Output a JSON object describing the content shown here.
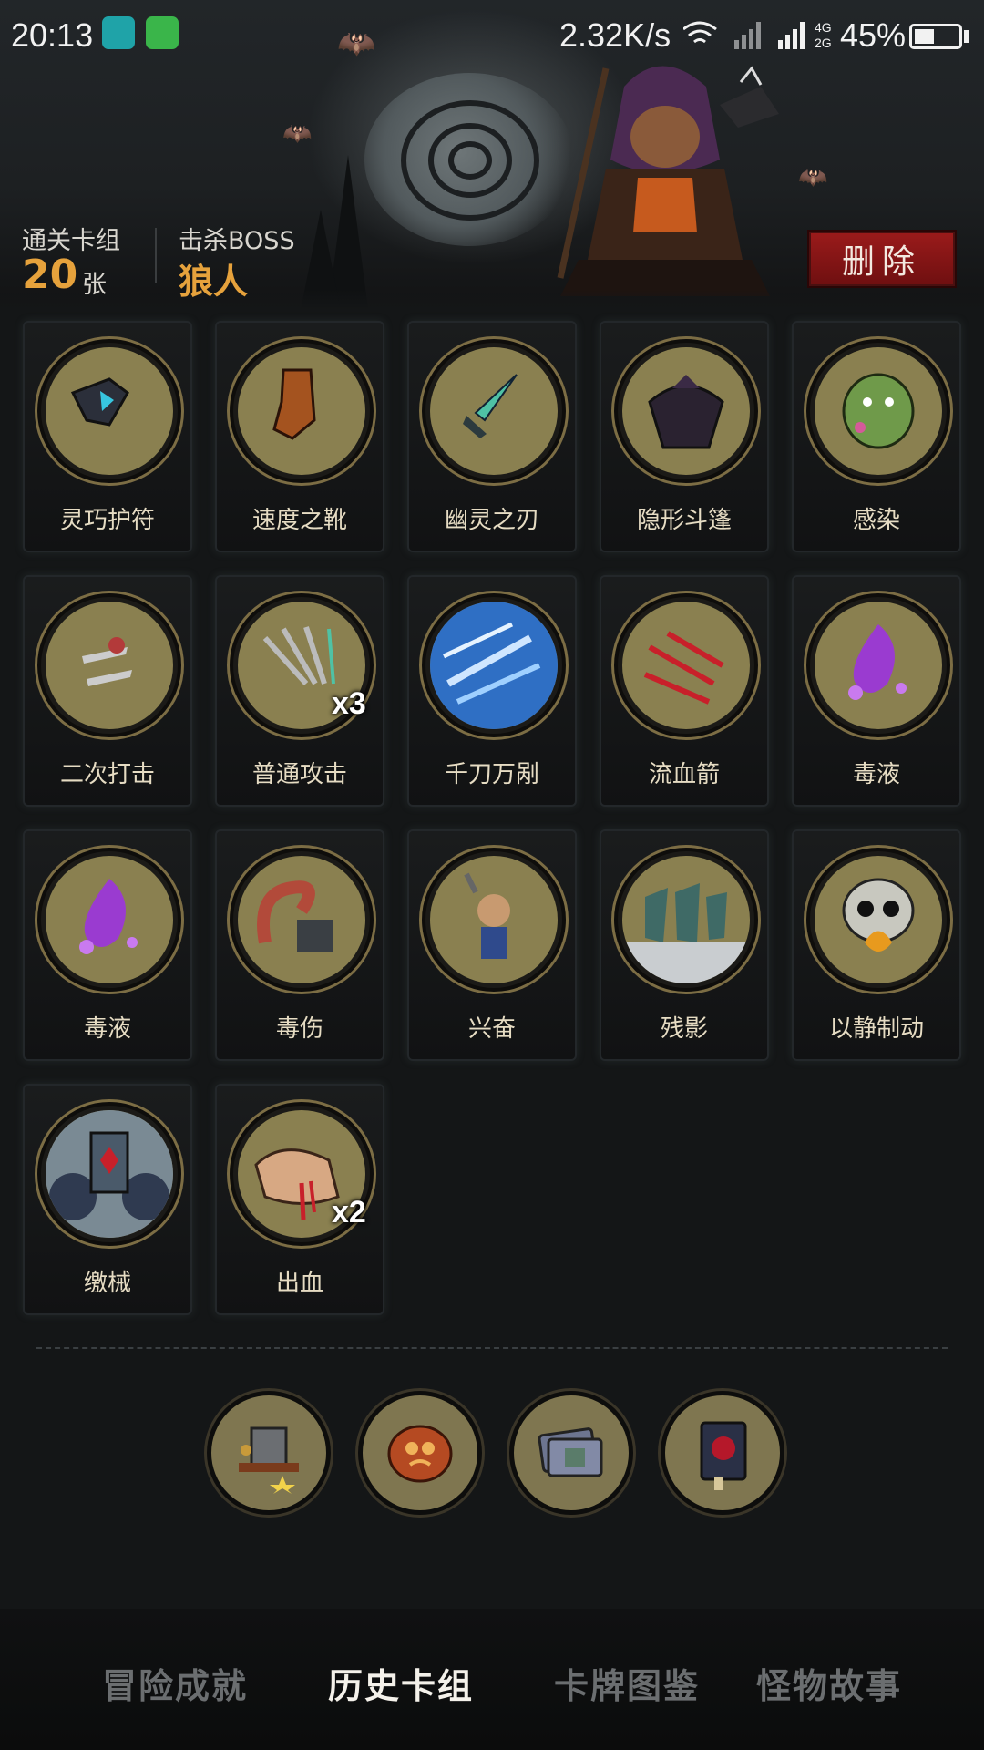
{
  "status_bar": {
    "time": "20:13",
    "network_speed": "2.32K/s",
    "net_4g": "4G",
    "net_2g": "2G",
    "battery_percent": "45%",
    "battery_level": 0.45
  },
  "summary": {
    "cleared_deck_label": "通关卡组",
    "cleared_deck_count": "20",
    "cleared_deck_unit": "张",
    "boss_label": "击杀BOSS",
    "boss_name": "狼人",
    "delete_label": "删除"
  },
  "cards": [
    {
      "name": "灵巧护符",
      "icon": "amulet-icon"
    },
    {
      "name": "速度之靴",
      "icon": "boot-icon"
    },
    {
      "name": "幽灵之刃",
      "icon": "ghost-blade-icon"
    },
    {
      "name": "隐形斗篷",
      "icon": "cloak-icon"
    },
    {
      "name": "感染",
      "icon": "infected-creature-icon"
    },
    {
      "name": "二次打击",
      "icon": "double-strike-icon"
    },
    {
      "name": "普通攻击",
      "icon": "daggers-icon",
      "count": "x3"
    },
    {
      "name": "千刀万剐",
      "icon": "blade-storm-icon"
    },
    {
      "name": "流血箭",
      "icon": "bleeding-arrows-icon"
    },
    {
      "name": "毒液",
      "icon": "poison-splash-icon"
    },
    {
      "name": "毒液",
      "icon": "poison-splash-icon"
    },
    {
      "name": "毒伤",
      "icon": "poison-tentacle-icon"
    },
    {
      "name": "兴奋",
      "icon": "excited-dwarf-icon"
    },
    {
      "name": "残影",
      "icon": "afterimage-icon"
    },
    {
      "name": "以静制动",
      "icon": "skull-fire-icon"
    },
    {
      "name": "缴械",
      "icon": "disarm-shield-icon"
    },
    {
      "name": "出血",
      "icon": "bleeding-hand-icon",
      "count": "x2"
    }
  ],
  "relics": [
    {
      "icon": "hammer-relic-icon"
    },
    {
      "icon": "cookie-relic-icon"
    },
    {
      "icon": "cards-relic-icon"
    },
    {
      "icon": "book-relic-icon"
    }
  ],
  "tabs": [
    {
      "label": "冒险成就",
      "active": false
    },
    {
      "label": "历史卡组",
      "active": true
    },
    {
      "label": "卡牌图鉴",
      "active": false
    },
    {
      "label": "怪物故事",
      "active": false
    }
  ],
  "colors": {
    "accent_gold": "#e6a23c",
    "delete_red": "#9b1b1b",
    "medal_olive": "#8a8050"
  }
}
